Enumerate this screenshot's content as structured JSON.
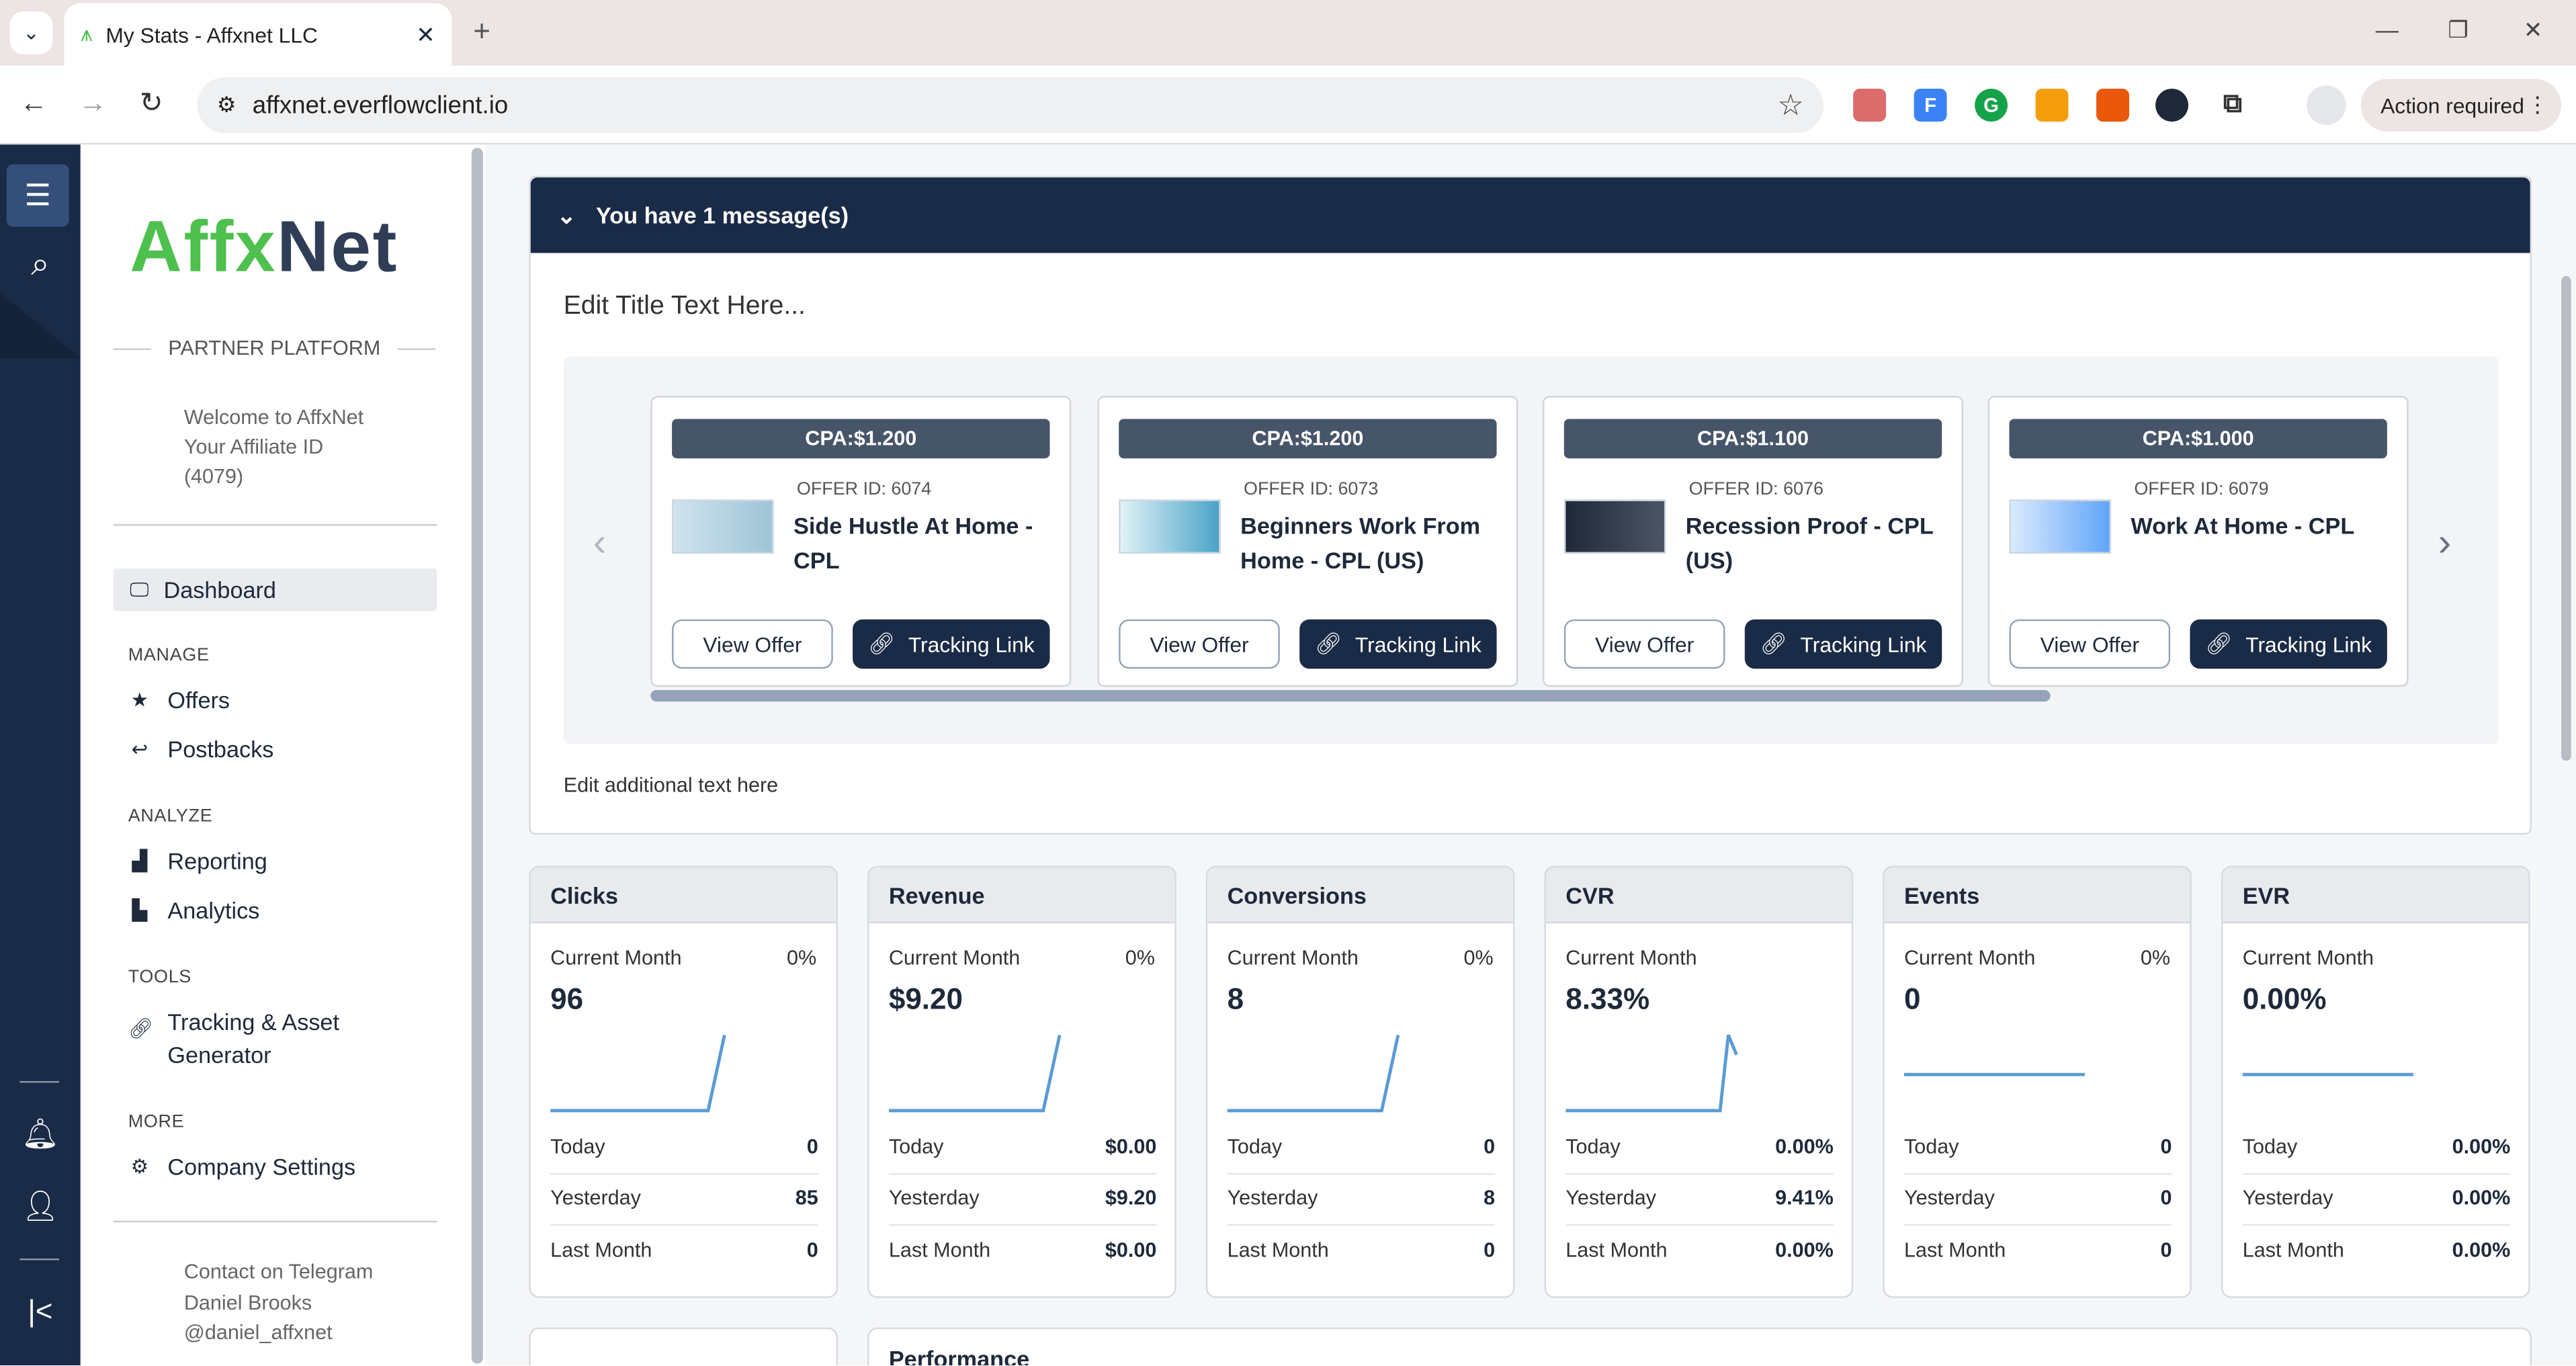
{
  "browser": {
    "tab_title": "My Stats - Affxnet LLC",
    "url": "affxnet.everflowclient.io",
    "action_label": "Action required"
  },
  "sidebar": {
    "logo_part1": "Affx",
    "logo_part2": "Net",
    "platform_label": "PARTNER PLATFORM",
    "welcome_line1": "Welcome to AffxNet",
    "welcome_line2": "Your Affiliate ID",
    "welcome_line3": "(4079)",
    "dashboard": "Dashboard",
    "sections": {
      "manage": "MANAGE",
      "analyze": "ANALYZE",
      "tools": "TOOLS",
      "more": "MORE"
    },
    "items": {
      "offers": "Offers",
      "postbacks": "Postbacks",
      "reporting": "Reporting",
      "analytics": "Analytics",
      "tracking_line1": "Tracking & Asset",
      "tracking_line2": "Generator",
      "company_settings": "Company Settings"
    },
    "contact_line1": "Contact on Telegram",
    "contact_line2": "Daniel Brooks",
    "contact_line3": "@daniel_affxnet"
  },
  "messages": {
    "header": "You have 1 message(s)",
    "edit_title": "Edit Title Text Here...",
    "additional_text": "Edit additional text here",
    "offers": [
      {
        "cpa": "CPA:$1.200",
        "offer_id": "OFFER ID: 6074",
        "name": "Side Hustle At Home - CPL",
        "view": "View Offer",
        "tracking": "Tracking Link"
      },
      {
        "cpa": "CPA:$1.200",
        "offer_id": "OFFER ID: 6073",
        "name": "Beginners Work From Home - CPL (US)",
        "view": "View Offer",
        "tracking": "Tracking Link"
      },
      {
        "cpa": "CPA:$1.100",
        "offer_id": "OFFER ID: 6076",
        "name": "Recession Proof - CPL (US)",
        "view": "View Offer",
        "tracking": "Tracking Link"
      },
      {
        "cpa": "CPA:$1.000",
        "offer_id": "OFFER ID: 6079",
        "name": "Work At Home - CPL",
        "view": "View Offer",
        "tracking": "Tracking Link"
      }
    ]
  },
  "stats": [
    {
      "title": "Clicks",
      "current_label": "Current Month",
      "pct": "0%",
      "value": "96",
      "today_label": "Today",
      "today": "0",
      "yesterday_label": "Yesterday",
      "yesterday": "85",
      "last_label": "Last Month",
      "last": "0"
    },
    {
      "title": "Revenue",
      "current_label": "Current Month",
      "pct": "0%",
      "value": "$9.20",
      "today_label": "Today",
      "today": "$0.00",
      "yesterday_label": "Yesterday",
      "yesterday": "$9.20",
      "last_label": "Last Month",
      "last": "$0.00"
    },
    {
      "title": "Conversions",
      "current_label": "Current Month",
      "pct": "0%",
      "value": "8",
      "today_label": "Today",
      "today": "0",
      "yesterday_label": "Yesterday",
      "yesterday": "8",
      "last_label": "Last Month",
      "last": "0"
    },
    {
      "title": "CVR",
      "current_label": "Current Month",
      "pct": "",
      "value": "8.33%",
      "today_label": "Today",
      "today": "0.00%",
      "yesterday_label": "Yesterday",
      "yesterday": "9.41%",
      "last_label": "Last Month",
      "last": "0.00%"
    },
    {
      "title": "Events",
      "current_label": "Current Month",
      "pct": "0%",
      "value": "0",
      "today_label": "Today",
      "today": "0",
      "yesterday_label": "Yesterday",
      "yesterday": "0",
      "last_label": "Last Month",
      "last": "0"
    },
    {
      "title": "EVR",
      "current_label": "Current Month",
      "pct": "",
      "value": "0.00%",
      "today_label": "Today",
      "today": "0.00%",
      "yesterday_label": "Yesterday",
      "yesterday": "0.00%",
      "last_label": "Last Month",
      "last": "0.00%"
    }
  ],
  "performance_title": "Performance",
  "colors": {
    "navy": "#1a2b47",
    "green": "#4ec04e",
    "slate": "#475569",
    "spark": "#5b9bd5"
  }
}
